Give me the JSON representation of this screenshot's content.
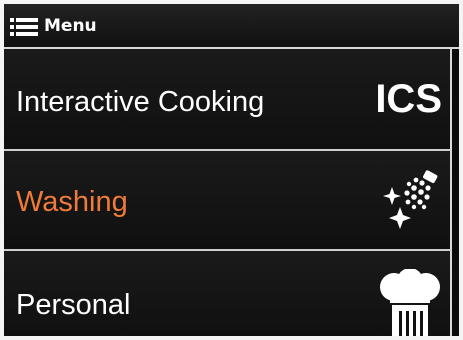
{
  "header": {
    "icon": "hamburger-menu-icon",
    "title": "Menu"
  },
  "menu": {
    "items": [
      {
        "label": "Interactive Cooking",
        "icon": "ics-logo-icon",
        "icon_text": "ICS",
        "active": false
      },
      {
        "label": "Washing",
        "icon": "washing-spray-icon",
        "active": true
      },
      {
        "label": "Personal",
        "icon": "chef-hat-icon",
        "active": false
      }
    ]
  },
  "colors": {
    "active_label": "#ef7a3a",
    "text": "#ffffff",
    "background": "#0b0b0b",
    "divider": "#cfcfcf"
  }
}
